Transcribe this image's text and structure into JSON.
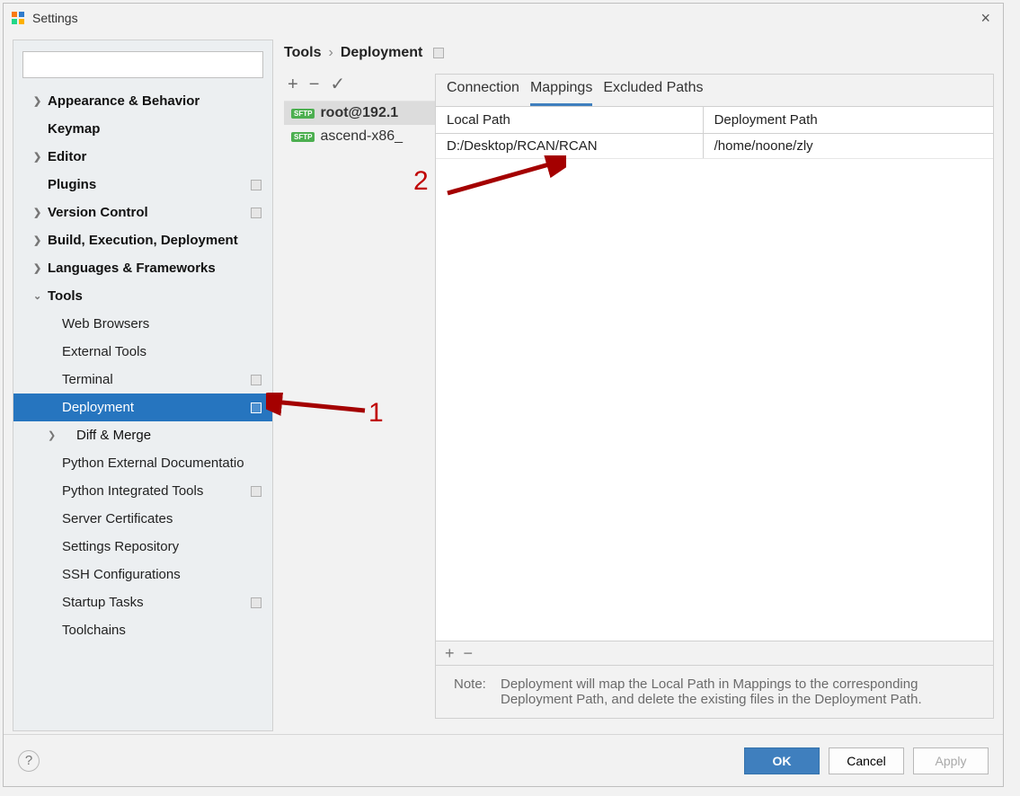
{
  "window": {
    "title": "Settings"
  },
  "search": {
    "placeholder": ""
  },
  "tree": {
    "appearance": "Appearance & Behavior",
    "keymap": "Keymap",
    "editor": "Editor",
    "plugins": "Plugins",
    "vcs": "Version Control",
    "build": "Build, Execution, Deployment",
    "lang": "Languages & Frameworks",
    "tools": "Tools",
    "web_browsers": "Web Browsers",
    "external_tools": "External Tools",
    "terminal": "Terminal",
    "deployment": "Deployment",
    "diff_merge": "Diff & Merge",
    "py_ext_doc": "Python External Documentatio",
    "py_int_tools": "Python Integrated Tools",
    "server_certs": "Server Certificates",
    "settings_repo": "Settings Repository",
    "ssh_conf": "SSH Configurations",
    "startup_tasks": "Startup Tasks",
    "toolchains": "Toolchains"
  },
  "breadcrumb": {
    "a": "Tools",
    "b": "Deployment"
  },
  "servers": {
    "s1": "root@192.1",
    "s2": "ascend-x86_"
  },
  "tabs": {
    "connection": "Connection",
    "mappings": "Mappings",
    "excluded": "Excluded Paths"
  },
  "mapHeaders": {
    "local": "Local Path",
    "deploy": "Deployment Path"
  },
  "mapRow": {
    "local": "D:/Desktop/RCAN/RCAN",
    "deploy": "/home/noone/zly"
  },
  "note": {
    "label": "Note:",
    "text": "Deployment will map the Local Path in Mappings to the corresponding Deployment Path, and delete the existing files in the Deployment Path."
  },
  "buttons": {
    "ok": "OK",
    "cancel": "Cancel",
    "apply": "Apply"
  },
  "annotations": {
    "one": "1",
    "two": "2"
  }
}
